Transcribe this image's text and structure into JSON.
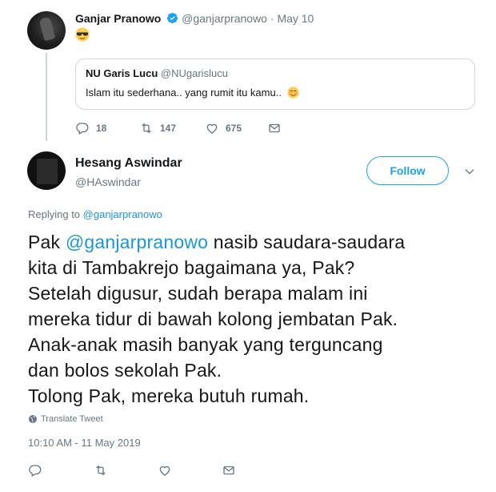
{
  "parent_tweet": {
    "author_name": "Ganjar Pranowo",
    "author_handle": "@ganjarpranowo",
    "separator": "·",
    "date": "May 10",
    "emoji": "sunglasses-emoji",
    "quoted_tweet": {
      "author_name": "NU Garis Lucu",
      "author_handle": "@NUgarislucu",
      "text": "Islam itu sederhana.. yang rumit itu kamu..",
      "emoji": "smiling-face-emoji"
    },
    "reply_count": "18",
    "retweet_count": "147",
    "like_count": "675"
  },
  "main_tweet": {
    "author_name": "Hesang Aswindar",
    "author_handle": "@HAswindar",
    "follow_label": "Follow",
    "replying_prefix": "Replying to",
    "replying_handle": "@ganjarpranowo",
    "body_lead": "Pak ",
    "body_mention": "@ganjarpranowo",
    "body_line1_rest": " nasib saudara-saudara",
    "body_lines": [
      "kita di Tambakrejo bagaimana ya, Pak?",
      "Setelah digusur, sudah berapa malam ini",
      "mereka tidur di bawah kolong jembatan Pak.",
      "Anak-anak masih banyak yang terguncang",
      "dan bolos sekolah Pak.",
      "Tolong Pak, mereka butuh rumah."
    ],
    "translate_label": "Translate Tweet",
    "timestamp": "10:10 AM - 11 May 2019"
  },
  "colors": {
    "accent": "#1da1f2",
    "link": "#1b95e0",
    "muted": "#657786",
    "border": "#ccd6dd"
  }
}
